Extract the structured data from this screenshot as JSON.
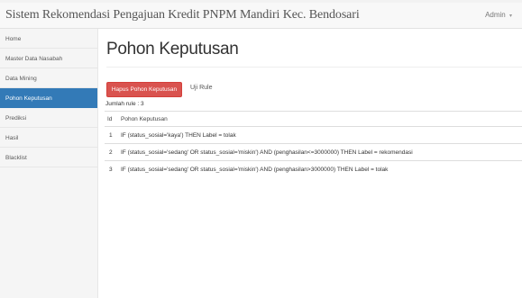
{
  "navbar": {
    "brand": "Sistem Rekomendasi Pengajuan Kredit PNPM Mandiri Kec. Bendosari",
    "user_label": "Admin",
    "user_caret": "▾"
  },
  "sidebar": {
    "items": [
      {
        "label": "Home"
      },
      {
        "label": "Master Data Nasabah"
      },
      {
        "label": "Data Mining"
      },
      {
        "label": "Pohon Keputusan",
        "active": true
      },
      {
        "label": "Prediksi"
      },
      {
        "label": "Hasil"
      },
      {
        "label": "Blacklist"
      }
    ]
  },
  "main": {
    "title": "Pohon Keputusan",
    "delete_button": "Hapus Pohon Keputusan",
    "test_link": "Uji Rule",
    "count_text": "Jumlah rule : 3",
    "table": {
      "headers": [
        "Id",
        "Pohon Keputusan"
      ],
      "rows": [
        {
          "id": "1",
          "rule": "IF (status_sosial='kaya') THEN Label = tolak"
        },
        {
          "id": "2",
          "rule": "IF (status_sosial='sedang' OR status_sosial='miskin') AND (penghasilan<=3000000) THEN Label = rekomendasi"
        },
        {
          "id": "3",
          "rule": "IF (status_sosial='sedang' OR status_sosial='miskin') AND (penghasilan>3000000) THEN Label = tolak"
        }
      ]
    }
  },
  "colors": {
    "active_nav": "#337ab7",
    "danger_button": "#d9534f"
  }
}
